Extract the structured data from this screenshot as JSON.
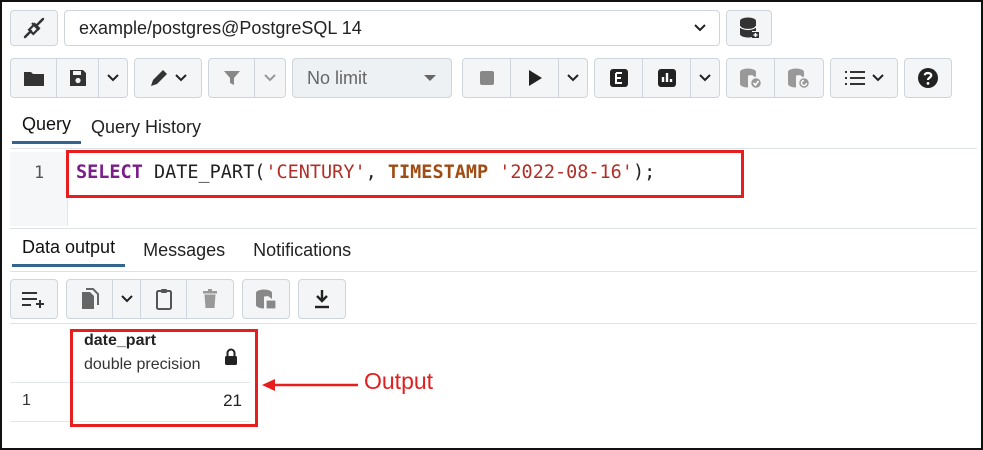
{
  "connection": {
    "value": "example/postgres@PostgreSQL 14"
  },
  "toolbar": {
    "limit_label": "No limit"
  },
  "query_tabs": [
    {
      "label": "Query",
      "active": true
    },
    {
      "label": "Query History",
      "active": false
    }
  ],
  "editor": {
    "line_number": "1",
    "code_tokens": {
      "select": "SELECT",
      "func": " DATE_PART(",
      "arg1": "'CENTURY'",
      "comma": ", ",
      "timestamp": "TIMESTAMP",
      "space": " ",
      "arg2": "'2022-08-16'",
      "end": ");"
    }
  },
  "result_tabs": [
    {
      "label": "Data output",
      "active": true
    },
    {
      "label": "Messages",
      "active": false
    },
    {
      "label": "Notifications",
      "active": false
    }
  ],
  "grid": {
    "columns": [
      {
        "name": "date_part",
        "type": "double precision"
      }
    ],
    "rows": [
      {
        "row_number": "1",
        "values": [
          "21"
        ]
      }
    ]
  },
  "annotation": {
    "output_label": "Output",
    "color": "#e81d1d"
  },
  "colors": {
    "accent": "#326690",
    "highlight": "#e81d1d"
  }
}
